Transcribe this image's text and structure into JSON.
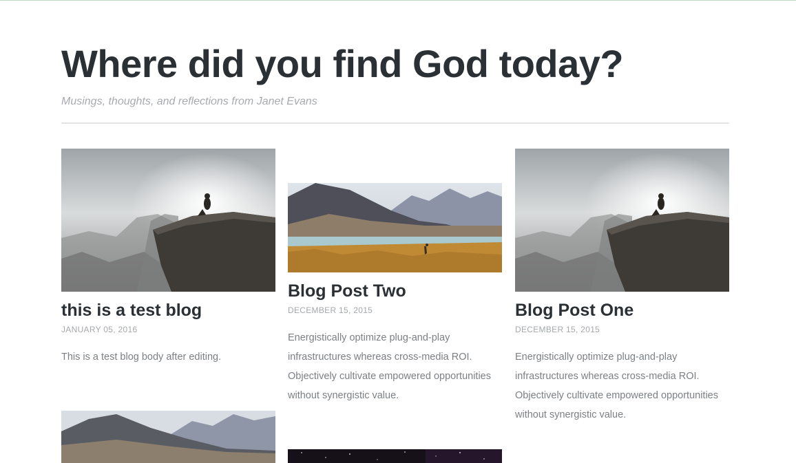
{
  "site": {
    "title": "Where did you find God today?",
    "subtitle": "Musings, thoughts, and reflections from Janet Evans"
  },
  "posts": [
    {
      "title": "this is a test blog",
      "date": "JANUARY 05, 2016",
      "excerpt": "This is a test blog body after editing.",
      "image": "person-on-cliff-photo"
    },
    {
      "title": "Blog Post Two",
      "date": "DECEMBER 15, 2015",
      "excerpt": "Energistically optimize plug-and-play infrastructures whereas cross-media ROI. Objectively cultivate empowered opportunities without synergistic value.",
      "image": "mountain-lake-llama-photo"
    },
    {
      "title": "Blog Post One",
      "date": "DECEMBER 15, 2015",
      "excerpt": "Energistically optimize plug-and-play infrastructures whereas cross-media ROI. Objectively cultivate empowered opportunities without synergistic value.",
      "image": "person-on-cliff-photo"
    },
    {
      "image": "mountain-landscape-photo"
    },
    {
      "image": "starry-night-photo"
    }
  ]
}
